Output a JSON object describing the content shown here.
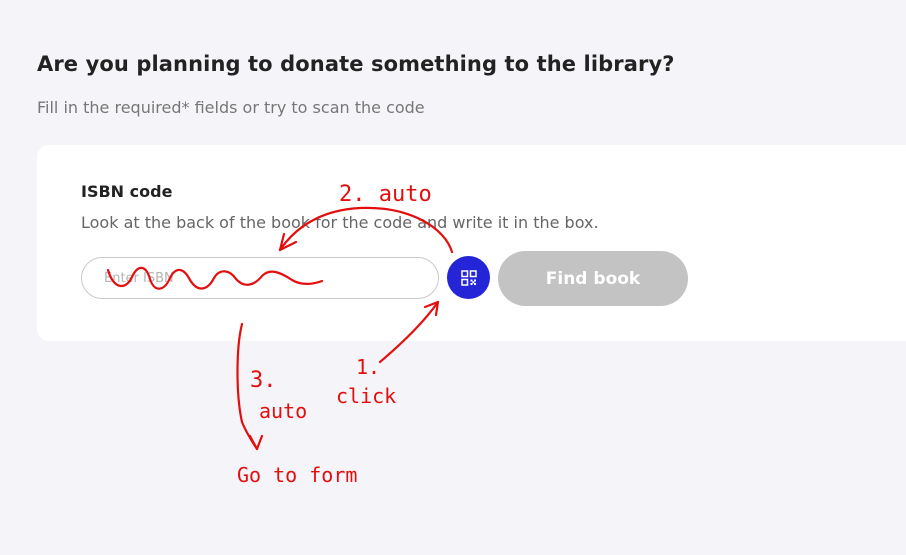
{
  "header": {
    "title": "Are you planning to donate something to the library?",
    "subtitle": "Fill in the required* fields or try to scan the code"
  },
  "isbn_card": {
    "title": "ISBN code",
    "hint": "Look at the back of the book for the code and write it in the box.",
    "input": {
      "value": "",
      "placeholder": "Enter ISBN"
    },
    "scan_button_icon": "qr-code-icon",
    "find_button_label": "Find book"
  },
  "annotations": {
    "step1_number": "1.",
    "step1_text": "click",
    "step2_text": "2. auto",
    "step3_number": "3.",
    "step3_text": "auto",
    "goto_form_text": "Go to form"
  },
  "colors": {
    "background": "#f5f5f9",
    "card": "#ffffff",
    "scan_button": "#2525d8",
    "find_button_disabled": "#c3c3c3",
    "annotation": "#e30f0f"
  }
}
